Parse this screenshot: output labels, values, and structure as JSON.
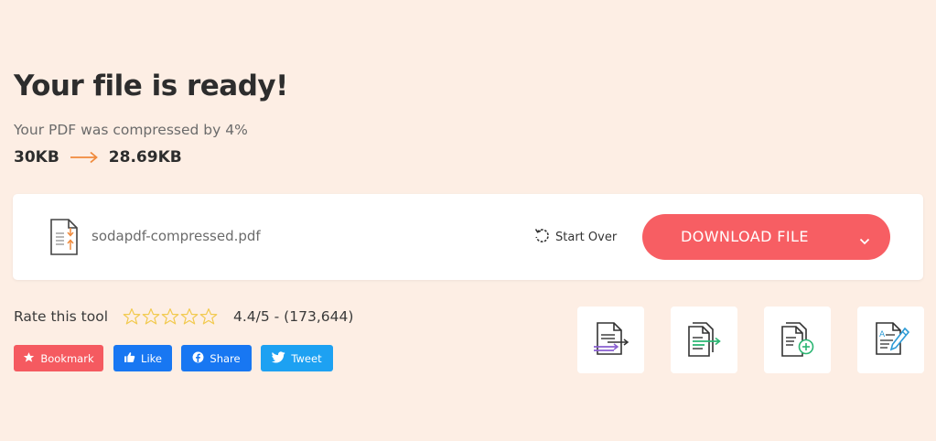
{
  "header": {
    "title": "Your file is ready!",
    "subtitle": "Your PDF was compressed by 4%",
    "original_size": "30KB",
    "compressed_size": "28.69KB"
  },
  "file_card": {
    "file_name": "sodapdf-compressed.pdf",
    "start_over_label": "Start Over",
    "download_label": "DOWNLOAD FILE"
  },
  "rating": {
    "label": "Rate this tool",
    "stars_total": 5,
    "score_text": "4.4/5 - (173,644)"
  },
  "social": {
    "bookmark": "Bookmark",
    "like": "Like",
    "share": "Share",
    "tweet": "Tweet"
  },
  "tools": [
    {
      "icon": "convert-pdf-icon"
    },
    {
      "icon": "export-pdf-icon"
    },
    {
      "icon": "merge-pdf-icon"
    },
    {
      "icon": "edit-pdf-icon"
    }
  ],
  "colors": {
    "background": "#fdeee4",
    "accent": "#f75e63",
    "arrow": "#f08a3c",
    "facebook": "#1877f2",
    "twitter": "#1da1f2",
    "star_outline": "#f2c94c"
  }
}
